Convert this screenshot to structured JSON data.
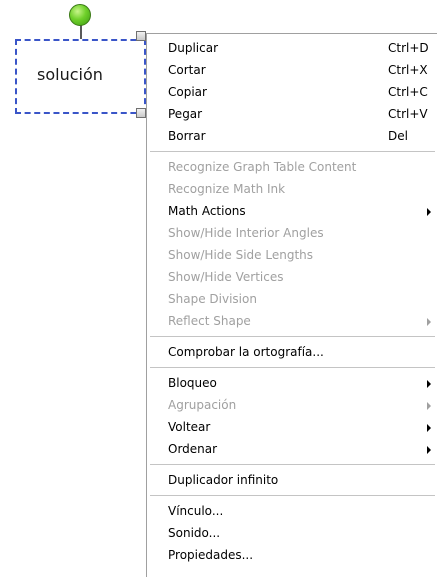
{
  "shape": {
    "text": "solución"
  },
  "menu": {
    "groups": [
      [
        {
          "label": "Duplicar",
          "shortcut": "Ctrl+D"
        },
        {
          "label": "Cortar",
          "shortcut": "Ctrl+X"
        },
        {
          "label": "Copiar",
          "shortcut": "Ctrl+C"
        },
        {
          "label": "Pegar",
          "shortcut": "Ctrl+V"
        },
        {
          "label": "Borrar",
          "shortcut": "Del"
        }
      ],
      [
        {
          "label": "Recognize Graph Table Content",
          "disabled": true
        },
        {
          "label": "Recognize Math Ink",
          "disabled": true
        },
        {
          "label": "Math Actions",
          "submenu": true
        },
        {
          "label": "Show/Hide Interior Angles",
          "disabled": true
        },
        {
          "label": "Show/Hide Side Lengths",
          "disabled": true
        },
        {
          "label": "Show/Hide Vertices",
          "disabled": true
        },
        {
          "label": "Shape Division",
          "disabled": true
        },
        {
          "label": "Reflect Shape",
          "disabled": true,
          "submenu": true
        }
      ],
      [
        {
          "label": "Comprobar la ortografía..."
        }
      ],
      [
        {
          "label": "Bloqueo",
          "submenu": true
        },
        {
          "label": "Agrupación",
          "disabled": true,
          "submenu": true
        },
        {
          "label": "Voltear",
          "submenu": true
        },
        {
          "label": "Ordenar",
          "submenu": true
        }
      ],
      [
        {
          "label": "Duplicador infinito"
        }
      ],
      [
        {
          "label": "Vínculo..."
        },
        {
          "label": "Sonido..."
        },
        {
          "label": "Propiedades..."
        }
      ]
    ]
  },
  "colors": {
    "selection_border": "#3a55c8",
    "disabled_text": "#a0a0a0",
    "rotate_handle": "#6fd02a"
  }
}
